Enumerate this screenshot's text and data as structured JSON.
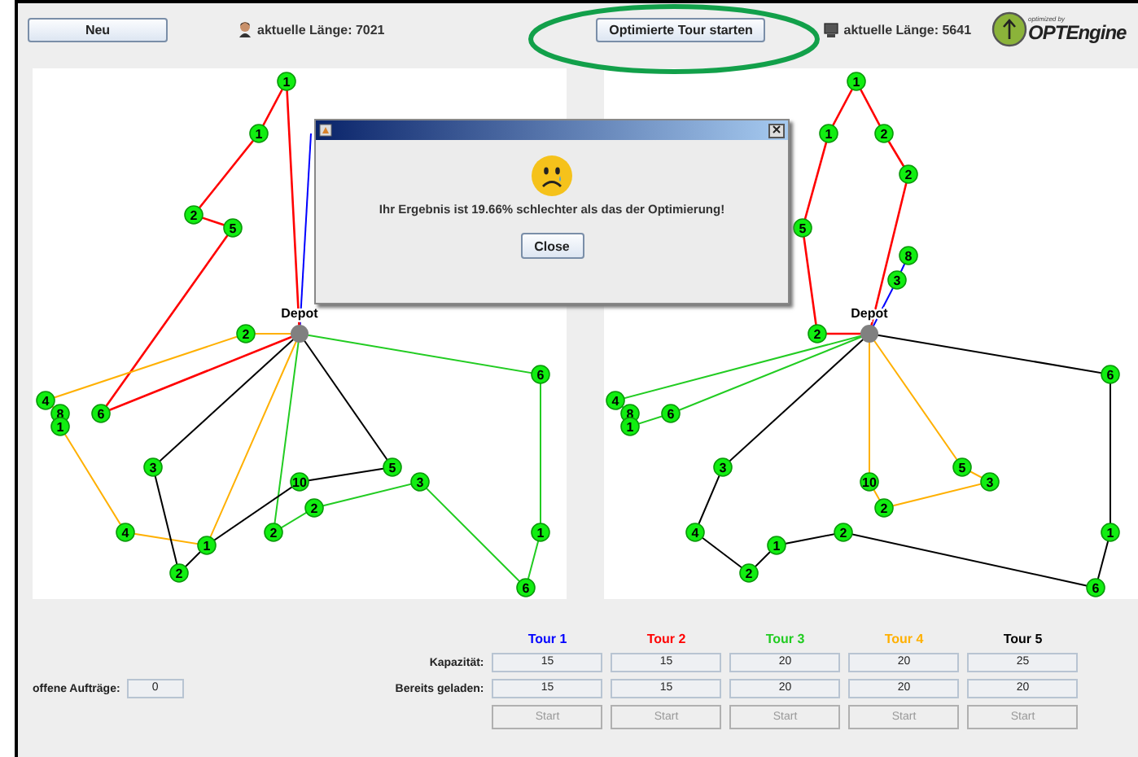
{
  "toolbar": {
    "new_button": "Neu",
    "user_length": "aktuelle Länge: 7021",
    "optimize_button": "Optimierte Tour starten",
    "optimized_length": "aktuelle Länge: 5641",
    "logo_tagline": "optimized by",
    "logo": "OPTEngine"
  },
  "maps": [
    {
      "depot_label": "Depot",
      "nodes": [
        {
          "label": "1"
        },
        {
          "label": "1"
        },
        {
          "label": "2"
        },
        {
          "label": "5"
        },
        {
          "label": "6"
        },
        {
          "label": "2"
        },
        {
          "label": "4"
        },
        {
          "label": "8"
        },
        {
          "label": "1"
        },
        {
          "label": "4"
        },
        {
          "label": "1"
        },
        {
          "label": "2"
        },
        {
          "label": "3"
        },
        {
          "label": "10"
        },
        {
          "label": "5"
        },
        {
          "label": "3"
        },
        {
          "label": "2"
        },
        {
          "label": "2"
        },
        {
          "label": "6"
        },
        {
          "label": "1"
        },
        {
          "label": "6"
        }
      ]
    },
    {
      "depot_label": "Depot",
      "nodes": [
        {
          "label": "1"
        },
        {
          "label": "1"
        },
        {
          "label": "2"
        },
        {
          "label": "2"
        },
        {
          "label": "5"
        },
        {
          "label": "2"
        },
        {
          "label": "8"
        },
        {
          "label": "3"
        },
        {
          "label": "4"
        },
        {
          "label": "8"
        },
        {
          "label": "1"
        },
        {
          "label": "6"
        },
        {
          "label": "3"
        },
        {
          "label": "4"
        },
        {
          "label": "2"
        },
        {
          "label": "1"
        },
        {
          "label": "2"
        },
        {
          "label": "6"
        },
        {
          "label": "1"
        },
        {
          "label": "6"
        },
        {
          "label": "10"
        },
        {
          "label": "2"
        },
        {
          "label": "3"
        },
        {
          "label": "5"
        }
      ]
    }
  ],
  "open_orders": {
    "label": "offene Aufträge:",
    "value": "0"
  },
  "row_labels": {
    "capacity": "Kapazität:",
    "loaded": "Bereits geladen:"
  },
  "tours": [
    {
      "name": "Tour 1",
      "color": "#0000ff",
      "capacity": "15",
      "loaded": "15",
      "start_button": "Start",
      "disabled": true
    },
    {
      "name": "Tour 2",
      "color": "#ff0000",
      "capacity": "15",
      "loaded": "15",
      "start_button": "Start",
      "disabled": true
    },
    {
      "name": "Tour 3",
      "color": "#22cc22",
      "capacity": "20",
      "loaded": "20",
      "start_button": "Start",
      "disabled": true
    },
    {
      "name": "Tour 4",
      "color": "#ffb000",
      "capacity": "20",
      "loaded": "20",
      "start_button": "Start",
      "disabled": true
    },
    {
      "name": "Tour 5",
      "color": "#000000",
      "capacity": "25",
      "loaded": "20",
      "start_button": "Start",
      "disabled": true
    }
  ],
  "dialog": {
    "message": "Ihr Ergebnis ist 19.66% schlechter als das der Optimierung!",
    "close_button": "Close"
  }
}
